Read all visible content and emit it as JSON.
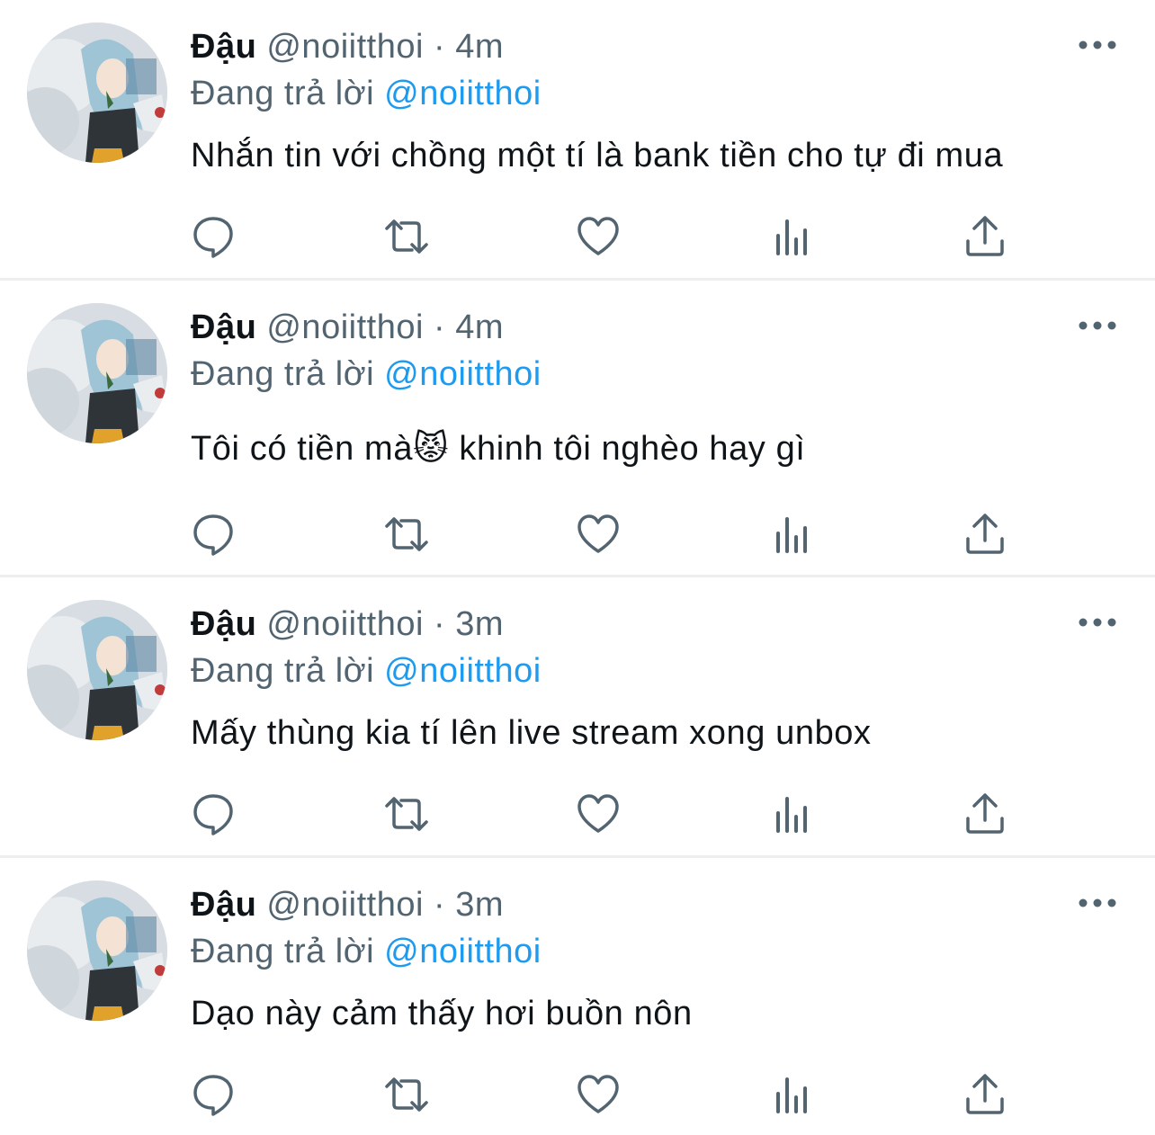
{
  "feed": {
    "tweets": [
      {
        "name": "Đậu",
        "handle": "@noiitthoi",
        "separator": "·",
        "time": "4m",
        "reply_prefix": "Đang trả lời",
        "reply_to": "@noiitthoi",
        "text": "Nhắn tin với chồng một tí là bank tiền cho tự đi mua"
      },
      {
        "name": "Đậu",
        "handle": "@noiitthoi",
        "separator": "·",
        "time": "4m",
        "reply_prefix": "Đang trả lời",
        "reply_to": "@noiitthoi",
        "text": "Tôi có tiền mà😾 khinh tôi nghèo hay gì"
      },
      {
        "name": "Đậu",
        "handle": "@noiitthoi",
        "separator": "·",
        "time": "3m",
        "reply_prefix": "Đang trả lời",
        "reply_to": "@noiitthoi",
        "text": "Mấy thùng kia tí lên live stream xong unbox"
      },
      {
        "name": "Đậu",
        "handle": "@noiitthoi",
        "separator": "·",
        "time": "3m",
        "reply_prefix": "Đang trả lời",
        "reply_to": "@noiitthoi",
        "text": "Dạo này cảm thấy hơi buồn nôn"
      }
    ],
    "icons": {
      "reply": "reply-icon",
      "retweet": "retweet-icon",
      "like": "heart-icon",
      "views": "views-bar-chart-icon",
      "share": "share-upload-icon",
      "more": "more-horizontal-icon"
    },
    "colors": {
      "text": "#0f1419",
      "secondary": "#536471",
      "mention": "#1d9bf0",
      "divider": "#eceef0"
    }
  }
}
